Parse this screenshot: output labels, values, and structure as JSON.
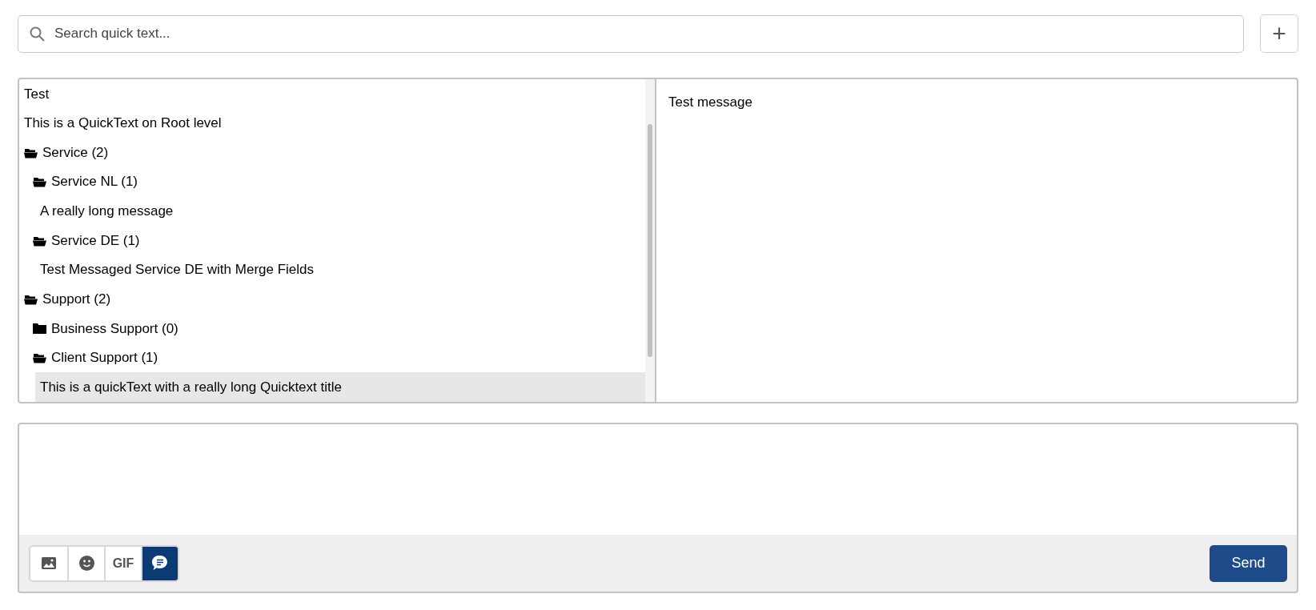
{
  "search": {
    "placeholder": "Search quick text..."
  },
  "add_button": {
    "label": "+"
  },
  "tree": [
    {
      "kind": "item",
      "label": "Test",
      "selected": false
    },
    {
      "kind": "item",
      "label": "This is a QuickText on Root level",
      "selected": false
    },
    {
      "kind": "folder",
      "label": "Service (2)",
      "expanded": true,
      "children": [
        {
          "kind": "folder",
          "label": "Service NL (1)",
          "expanded": true,
          "children": [
            {
              "kind": "item",
              "label": "A really long message",
              "selected": false
            }
          ]
        },
        {
          "kind": "folder",
          "label": "Service DE (1)",
          "expanded": true,
          "children": [
            {
              "kind": "item",
              "label": "Test Messaged Service DE with Merge Fields",
              "selected": false
            }
          ]
        }
      ]
    },
    {
      "kind": "folder",
      "label": "Support (2)",
      "expanded": true,
      "children": [
        {
          "kind": "folder",
          "label": "Business Support (0)",
          "expanded": false
        },
        {
          "kind": "folder",
          "label": "Client Support (1)",
          "expanded": true,
          "children": [
            {
              "kind": "item",
              "label": "This is a quickText with a really long Quicktext title",
              "selected": true
            }
          ]
        }
      ]
    }
  ],
  "preview": {
    "text": "Test message"
  },
  "composer": {
    "tools": [
      {
        "kind": "image",
        "selected": false
      },
      {
        "kind": "emoji",
        "selected": false
      },
      {
        "kind": "gif",
        "label": "GIF",
        "selected": false
      },
      {
        "kind": "quicktext",
        "selected": true
      }
    ],
    "send_button": "Send"
  }
}
